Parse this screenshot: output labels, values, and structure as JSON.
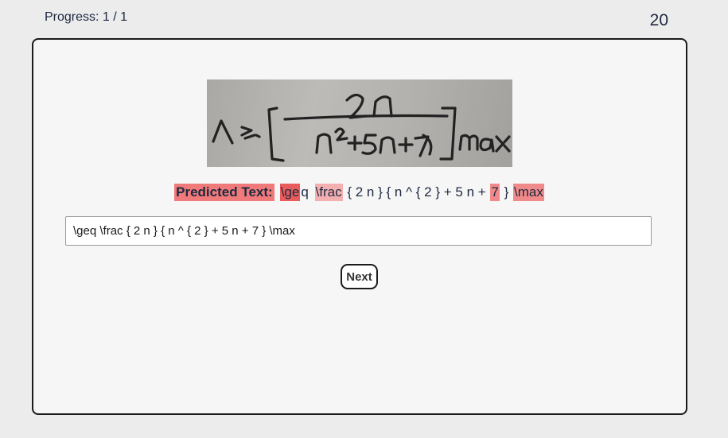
{
  "header": {
    "progress": "Progress: 1 / 1",
    "counter": "20"
  },
  "card": {
    "image_content": "\\geq \\frac{2n}{n^2+5n+7} max",
    "predicted_label": "Predicted Text:",
    "predicted_tokens": [
      {
        "text": "\\ge",
        "highlight": "strong"
      },
      {
        "text": "q",
        "highlight": "none"
      },
      {
        "text": " ",
        "highlight": "none"
      },
      {
        "text": "\\frac",
        "highlight": "light"
      },
      {
        "text": " { 2 n } { n ^ { 2 } + 5 n + ",
        "highlight": "none"
      },
      {
        "text": "7",
        "highlight": "mid"
      },
      {
        "text": " } ",
        "highlight": "none"
      },
      {
        "text": "\\max",
        "highlight": "mid"
      }
    ],
    "answer_value": "\\geq \\frac { 2 n } { n ^ { 2 } + 5 n + 7 } \\max",
    "next_label": "Next"
  },
  "colors": {
    "page_bg": "#ececec",
    "card_bg": "#f6f6f6",
    "highlight_strong": "#e85c5c",
    "highlight_mid": "#f08a8a",
    "highlight_light": "#f4b0b0",
    "text": "#1d2940"
  }
}
